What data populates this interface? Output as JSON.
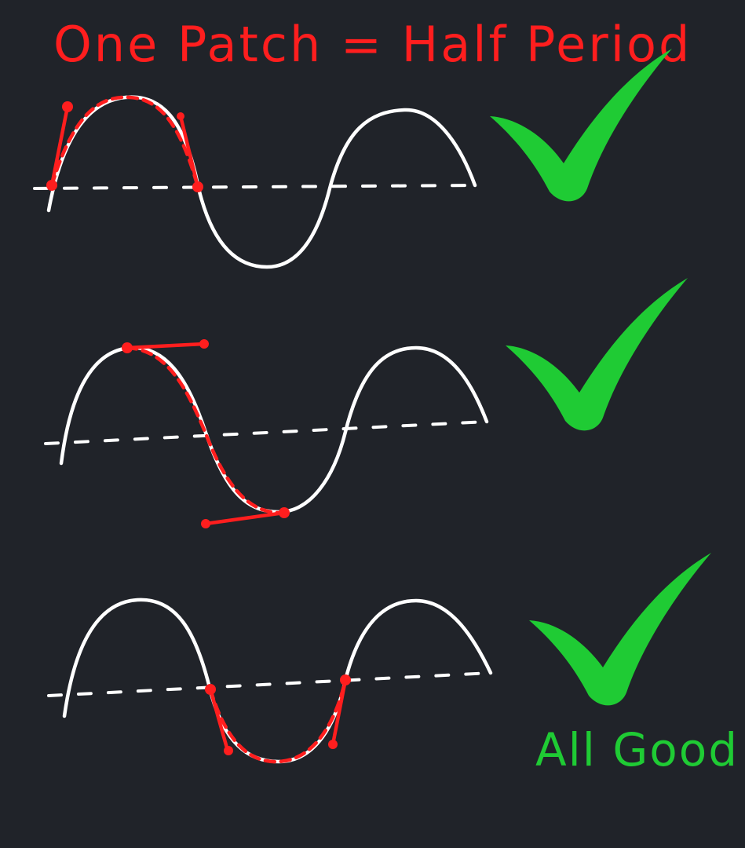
{
  "title": "One Patch = Half Period",
  "caption": "All Good",
  "colors": {
    "background": "#202329",
    "curve": "#ffffff",
    "patch": "#ff1e1e",
    "check": "#1fcb34"
  },
  "panels": [
    {
      "status": "check-icon"
    },
    {
      "status": "check-icon"
    },
    {
      "status": "check-icon"
    }
  ]
}
